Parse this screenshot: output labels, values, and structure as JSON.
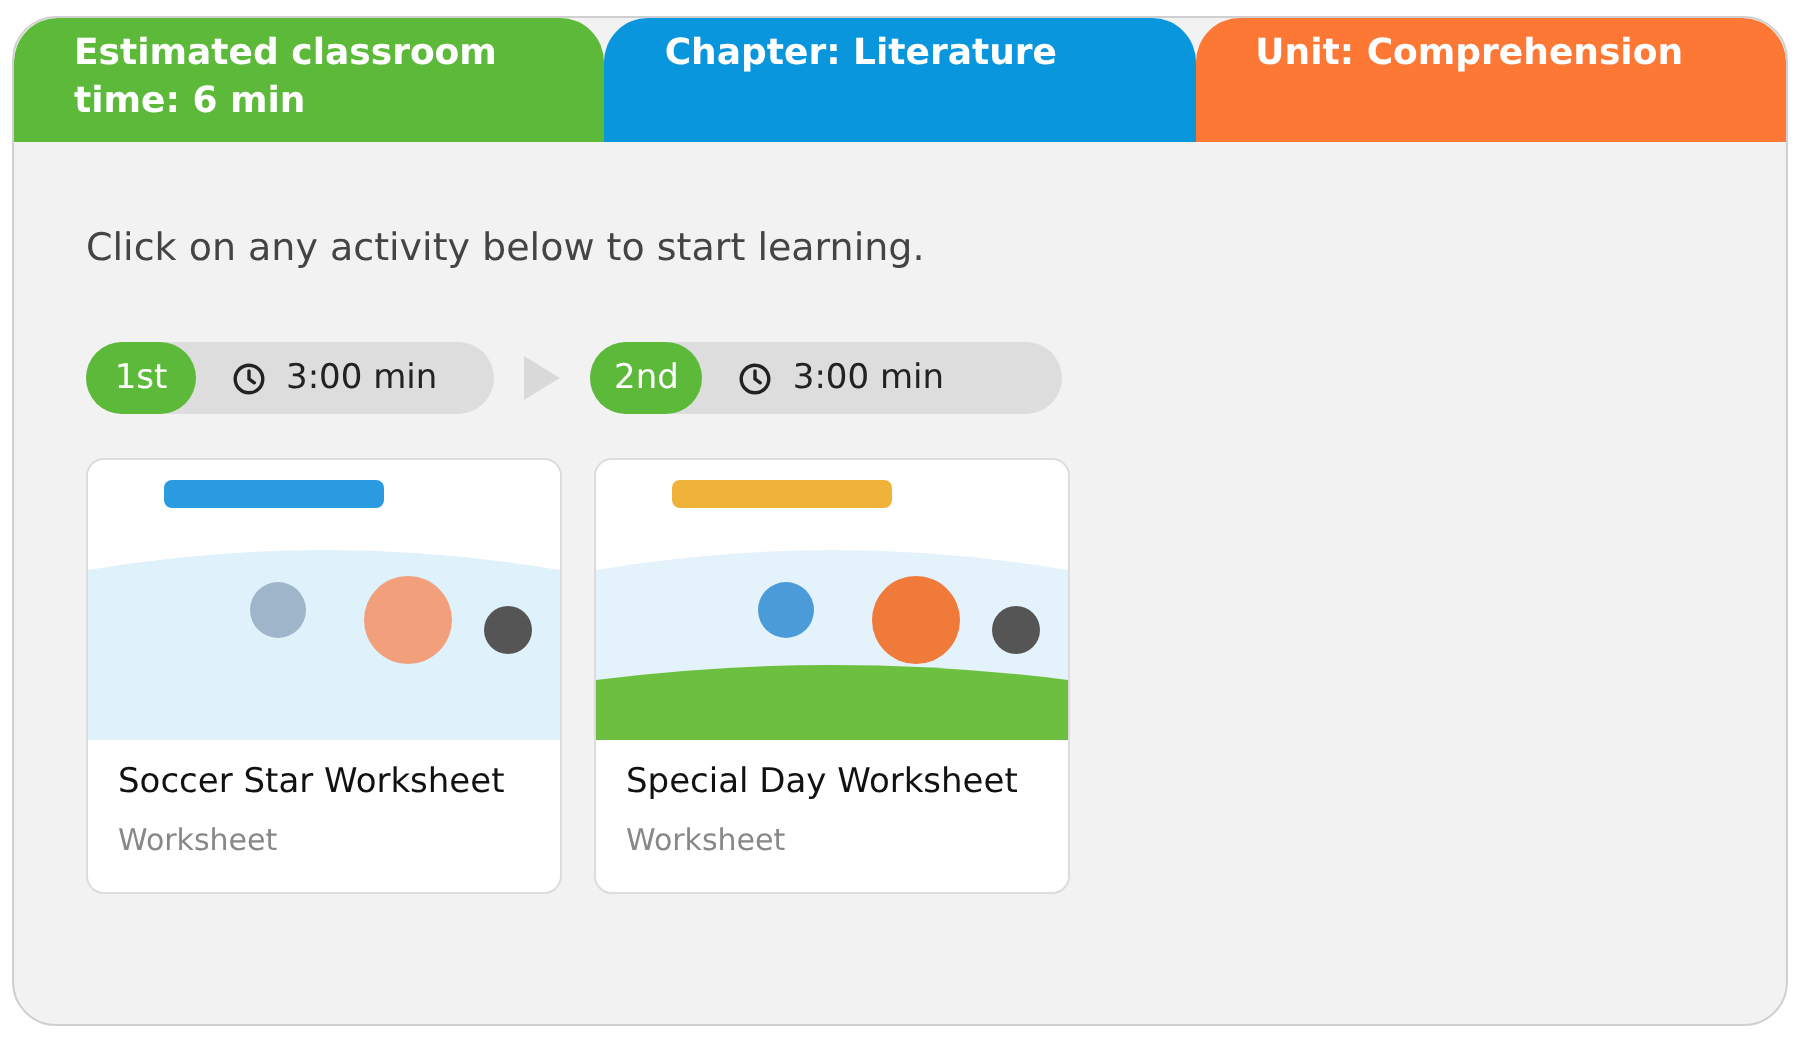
{
  "header_tabs": [
    {
      "label": "Estimated classroom time: 6 min",
      "color": "#5db93a"
    },
    {
      "label": "Chapter: Literature",
      "color": "#0a96dc"
    },
    {
      "label": "Unit: Comprehension",
      "color": "#fd7735"
    }
  ],
  "instruction": "Click on any activity below to start learning.",
  "steps": [
    {
      "order": "1st",
      "duration": "3:00 min"
    },
    {
      "order": "2nd",
      "duration": "3:00 min"
    }
  ],
  "activities": [
    {
      "title": "Soccer Star Worksheet",
      "type": "Worksheet"
    },
    {
      "title": "Special Day Worksheet",
      "type": "Worksheet"
    }
  ]
}
